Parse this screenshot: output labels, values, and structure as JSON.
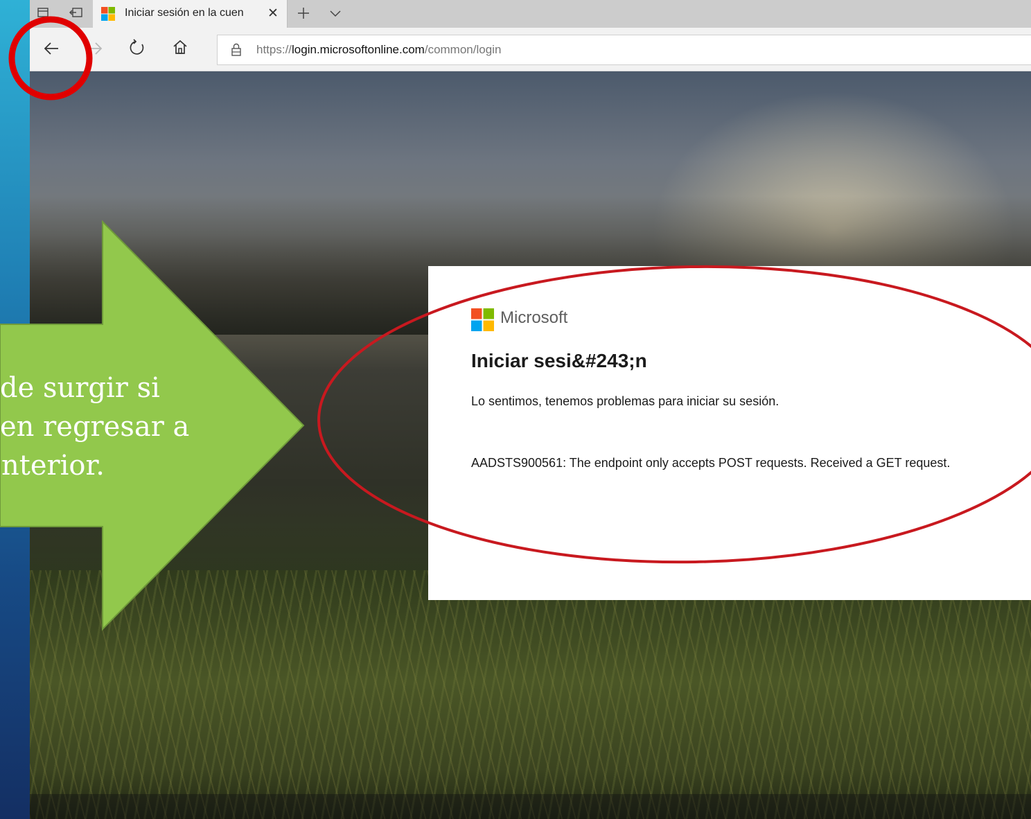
{
  "browser": {
    "tab": {
      "title": "Iniciar sesión en la cuen",
      "close_glyph": "✕"
    },
    "tabbar_icons": [
      "tab-preview-icon",
      "set-aside-tabs-icon",
      "new-tab-plus-icon",
      "tab-list-chevron-icon"
    ],
    "address": {
      "scheme": "https://",
      "host": "login.microsoftonline.com",
      "path": "/common/login"
    }
  },
  "card": {
    "brand": "Microsoft",
    "title": "Iniciar sesi&#243;n",
    "message": "Lo sentimos, tenemos problemas para iniciar su sesión.",
    "error": "AADSTS900561: The endpoint only accepts POST requests. Received a GET request."
  },
  "annotation": {
    "arrow_lines": [
      "de surgir si",
      "en regresar a",
      "nterior."
    ],
    "arrow_color": "#92c84c",
    "circle_color": "#e00000",
    "ellipse_color": "#c8191f"
  },
  "colors": {
    "ms_red": "#f25022",
    "ms_green": "#7fba00",
    "ms_blue": "#00a4ef",
    "ms_yellow": "#ffb900"
  }
}
